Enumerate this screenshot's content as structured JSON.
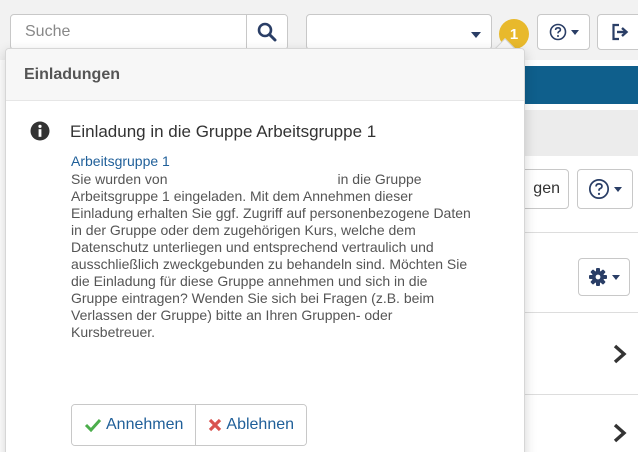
{
  "topbar": {
    "search_placeholder": "Suche",
    "search_icon": "search-icon",
    "notification_count": "1",
    "help_icon": "help-circle-icon",
    "logout_icon": "logout-icon"
  },
  "background": {
    "partial_button_label": "gen",
    "help_icon": "help-circle-icon",
    "settings_icon": "gear-icon",
    "row_icon": "chevron-right-icon"
  },
  "popover": {
    "header": "Einladungen",
    "invitation": {
      "icon": "info-icon",
      "title": "Einladung in die Gruppe Arbeitsgruppe 1",
      "group_link": "Arbeitsgruppe 1",
      "text_start": "Sie wurden von",
      "text_rest": "in die Gruppe Arbeitsgruppe 1 eingeladen. Mit dem Annehmen dieser Einladung erhalten Sie ggf. Zugriff auf personenbezogene Daten in der Gruppe oder dem zugehörigen Kurs, welche dem Datenschutz unterliegen und entsprechend vertraulich und ausschließlich zweckgebunden zu behandeln sind. Möchten Sie die Einladung für diese Gruppe annehmen und sich in die Gruppe eintragen? Wenden Sie sich bei Fragen (z.B. beim Verlassen der Gruppe) bitte an Ihren Gruppen- oder Kursbetreuer.",
      "accept_label": "Annehmen",
      "decline_label": "Ablehnen"
    }
  },
  "colors": {
    "link": "#1f5f99",
    "accent_blue": "#0f5f8c",
    "badge": "#e8b92c",
    "accept_check": "#4cae4c",
    "decline_x": "#d9534f"
  }
}
